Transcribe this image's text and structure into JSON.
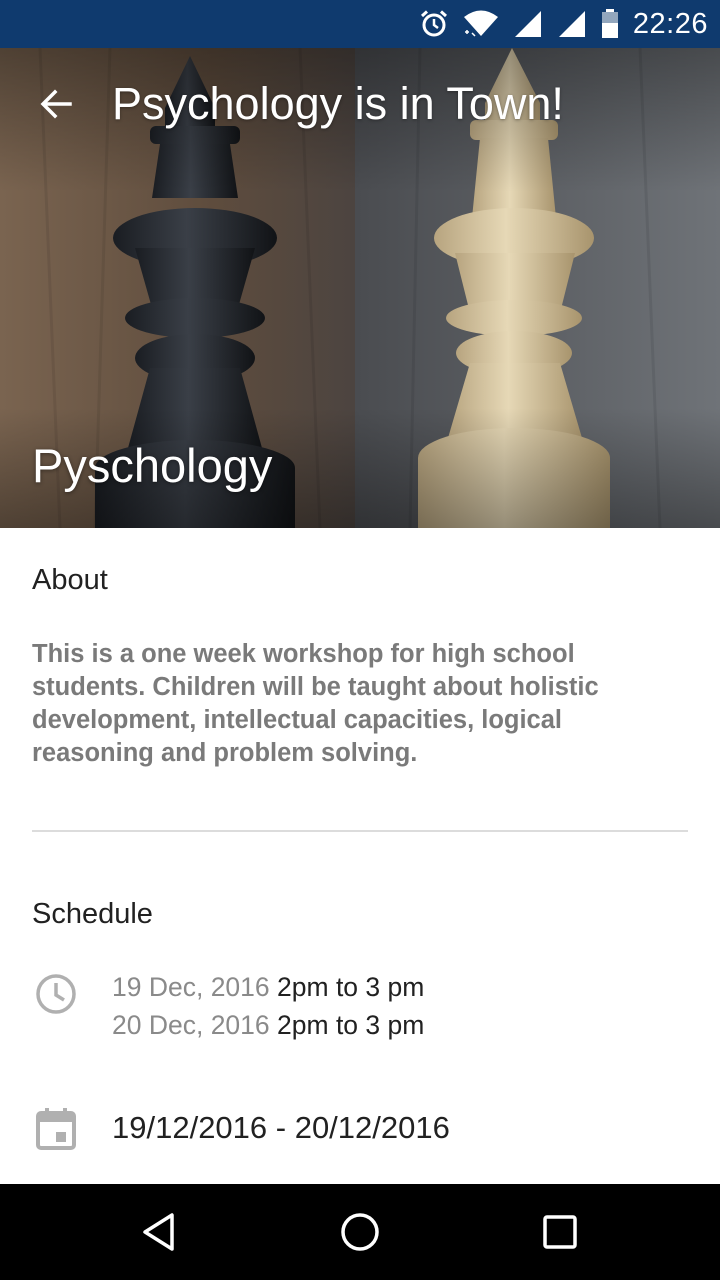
{
  "status_bar": {
    "time": "22:26",
    "icons": [
      "alarm-icon",
      "wifi-icon",
      "signal-icon",
      "signal-icon",
      "battery-icon"
    ]
  },
  "toolbar": {
    "back_icon": "arrow-back-icon",
    "title": "Psychology is in Town!"
  },
  "hero": {
    "caption": "Pyschology"
  },
  "about": {
    "heading": "About",
    "body": "This is a one week workshop for high school students. Children will be taught about holistic development, intellectual capacities, logical reasoning and problem solving."
  },
  "schedule": {
    "heading": "Schedule",
    "icon": "clock-icon",
    "entries": [
      {
        "date": "19 Dec, 2016",
        "time": "2pm to 3 pm"
      },
      {
        "date": "20 Dec, 2016",
        "time": "2pm to 3 pm"
      }
    ]
  },
  "date_range": {
    "icon": "calendar-icon",
    "text": "19/12/2016 - 20/12/2016"
  },
  "nav_bar": {
    "icons": [
      "back-triangle-icon",
      "home-circle-icon",
      "recents-square-icon"
    ]
  }
}
